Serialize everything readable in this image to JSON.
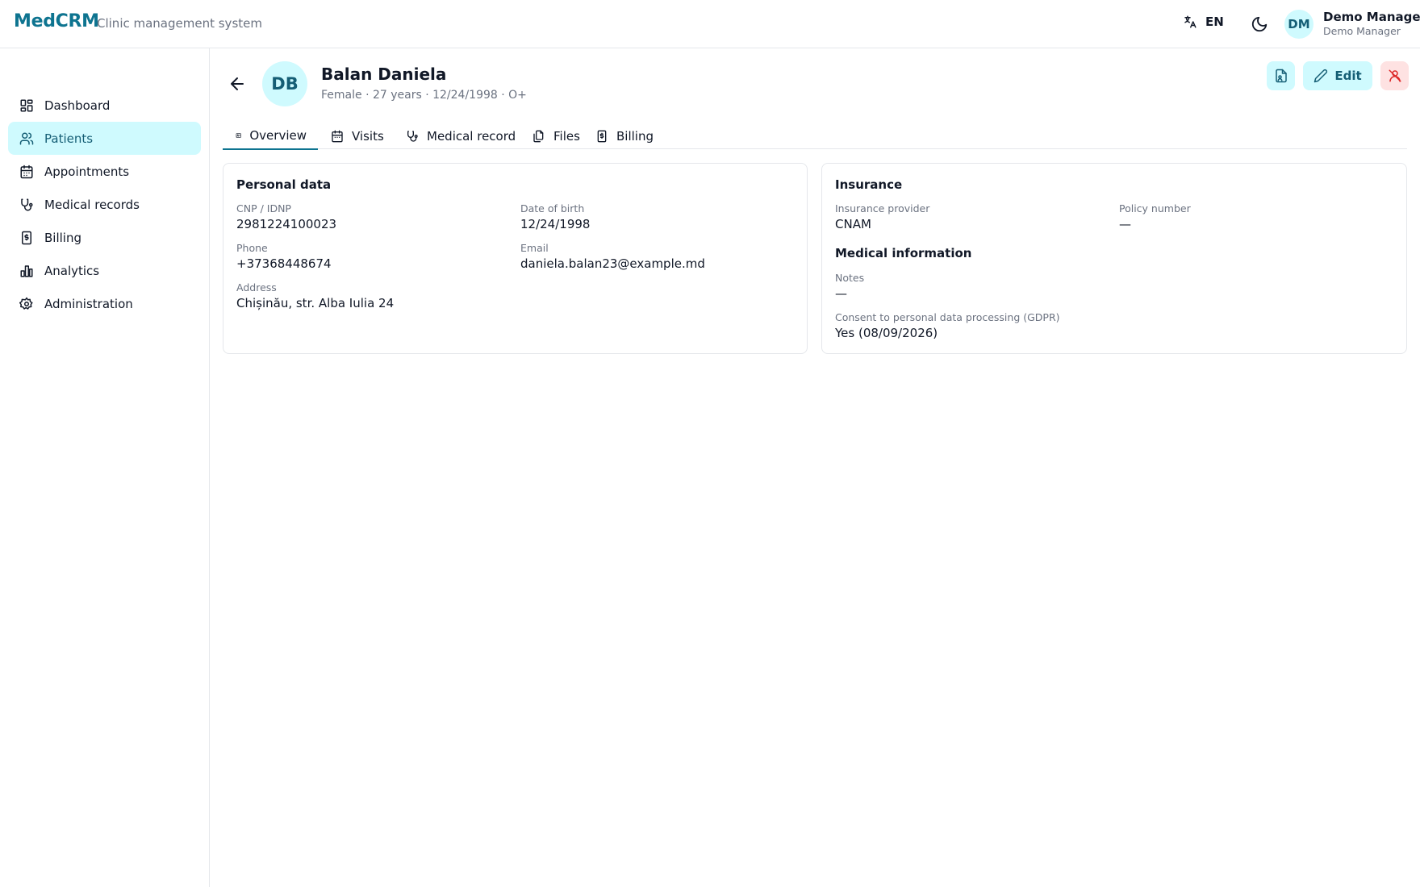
{
  "app": {
    "brand": "MedCRM",
    "subtitle": "Clinic management system",
    "language": "EN",
    "user_initials": "DM",
    "user_name": "Demo Manager",
    "user_role": "Demo Manager",
    "accent_color": "#0e7490"
  },
  "sidebar": {
    "items": [
      {
        "label": "Dashboard",
        "icon": "dashboard-icon",
        "active": false
      },
      {
        "label": "Patients",
        "icon": "users-icon",
        "active": true
      },
      {
        "label": "Appointments",
        "icon": "calendar-icon",
        "active": false
      },
      {
        "label": "Medical records",
        "icon": "stethoscope-icon",
        "active": false
      },
      {
        "label": "Billing",
        "icon": "receipt-dollar-icon",
        "active": false
      },
      {
        "label": "Analytics",
        "icon": "bar-chart-icon",
        "active": false
      },
      {
        "label": "Administration",
        "icon": "gear-icon",
        "active": false
      }
    ]
  },
  "patient": {
    "initials": "DB",
    "name": "Balan Daniela",
    "meta": "Female · 27 years · 12/24/1998 · O+"
  },
  "actions": {
    "edit_label": "Edit"
  },
  "tabs": [
    {
      "label": "Overview",
      "icon": "id-card-icon",
      "active": true
    },
    {
      "label": "Visits",
      "icon": "calendar-icon",
      "active": false
    },
    {
      "label": "Medical record",
      "icon": "stethoscope-icon",
      "active": false
    },
    {
      "label": "Files",
      "icon": "files-icon",
      "active": false
    },
    {
      "label": "Billing",
      "icon": "receipt-dollar-icon",
      "active": false
    }
  ],
  "personal": {
    "title": "Personal data",
    "cnp_label": "CNP / IDNP",
    "cnp": "2981224100023",
    "dob_label": "Date of birth",
    "dob": "12/24/1998",
    "phone_label": "Phone",
    "phone": "+37368448674",
    "email_label": "Email",
    "email": "daniela.balan23@example.md",
    "address_label": "Address",
    "address": "Chișinău, str. Alba Iulia 24"
  },
  "insurance": {
    "title": "Insurance",
    "provider_label": "Insurance provider",
    "provider": "CNAM",
    "policy_label": "Policy number",
    "policy": "—"
  },
  "medical": {
    "title": "Medical information",
    "notes_label": "Notes",
    "notes": "—",
    "consent_label": "Consent to personal data processing (GDPR)",
    "consent": "Yes (08/09/2026)"
  }
}
